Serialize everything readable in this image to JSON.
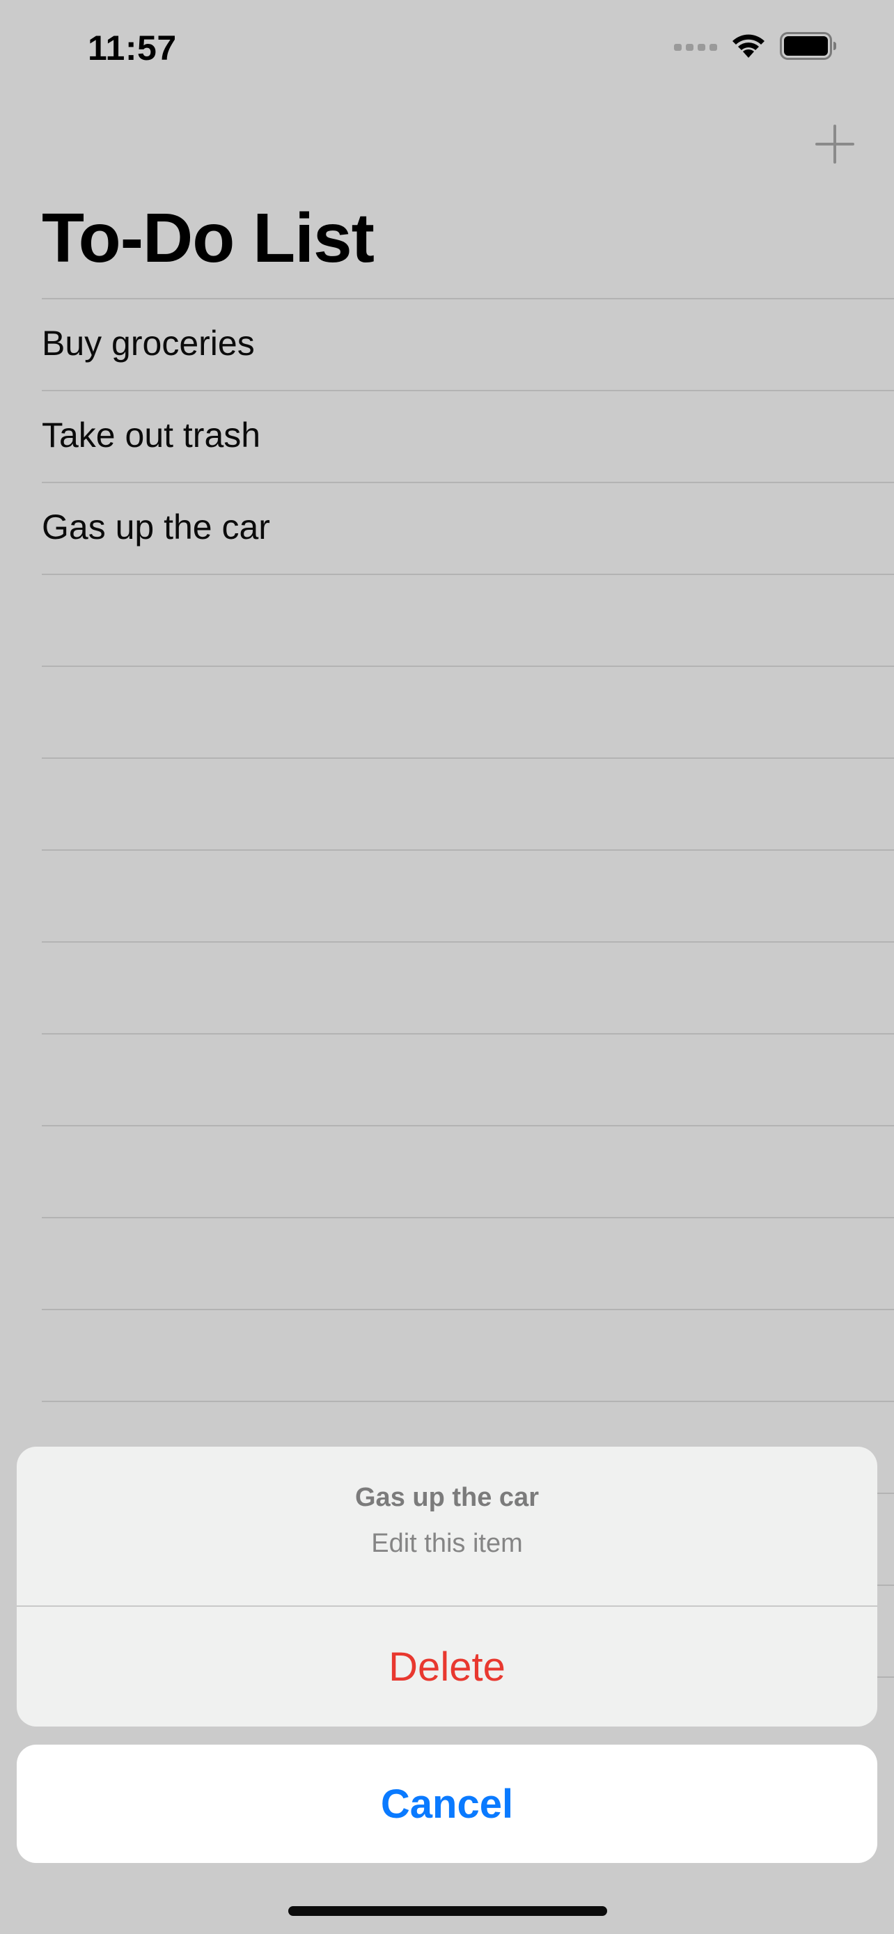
{
  "status_bar": {
    "time": "11:57",
    "icons": [
      "cellular-signal-icon",
      "wifi-icon",
      "battery-icon"
    ]
  },
  "nav": {
    "add_icon": "plus-icon"
  },
  "page": {
    "title": "To-Do List"
  },
  "list": {
    "items": [
      {
        "label": "Buy groceries"
      },
      {
        "label": "Take out trash"
      },
      {
        "label": "Gas up the car"
      },
      {
        "label": ""
      },
      {
        "label": ""
      },
      {
        "label": ""
      },
      {
        "label": ""
      },
      {
        "label": ""
      },
      {
        "label": ""
      },
      {
        "label": ""
      },
      {
        "label": ""
      },
      {
        "label": ""
      },
      {
        "label": ""
      },
      {
        "label": ""
      },
      {
        "label": ""
      },
      {
        "label": ""
      }
    ]
  },
  "action_sheet": {
    "title": "Gas up the car",
    "message": "Edit this item",
    "destructive_label": "Delete",
    "cancel_label": "Cancel"
  },
  "colors": {
    "background": "#cbcbcb",
    "destructive": "#e8382f",
    "accent": "#0a7aff"
  }
}
